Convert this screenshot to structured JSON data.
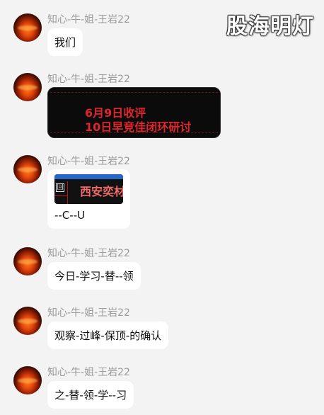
{
  "watermark": "股海明灯",
  "messages": [
    {
      "sender": "知心-牛-姐-王岩22",
      "text": "我们"
    },
    {
      "sender": "知心-牛-姐-王岩22",
      "card_line1": "6月9日收评",
      "card_line2": "10日早竞佳闭环研讨"
    },
    {
      "sender": "知心-牛-姐-王岩22",
      "thumb_title": "西安奕材",
      "thumb_icon": "回",
      "link_text": "--C--U"
    },
    {
      "sender": "知心-牛-姐-王岩22",
      "text": "今日-学习-替--领"
    },
    {
      "sender": "知心-牛-姐-王岩22",
      "text": "观察-过峰-保顶-的确认"
    },
    {
      "sender": "知心-牛-姐-王岩22",
      "text": "之-替-领-学--习"
    }
  ]
}
